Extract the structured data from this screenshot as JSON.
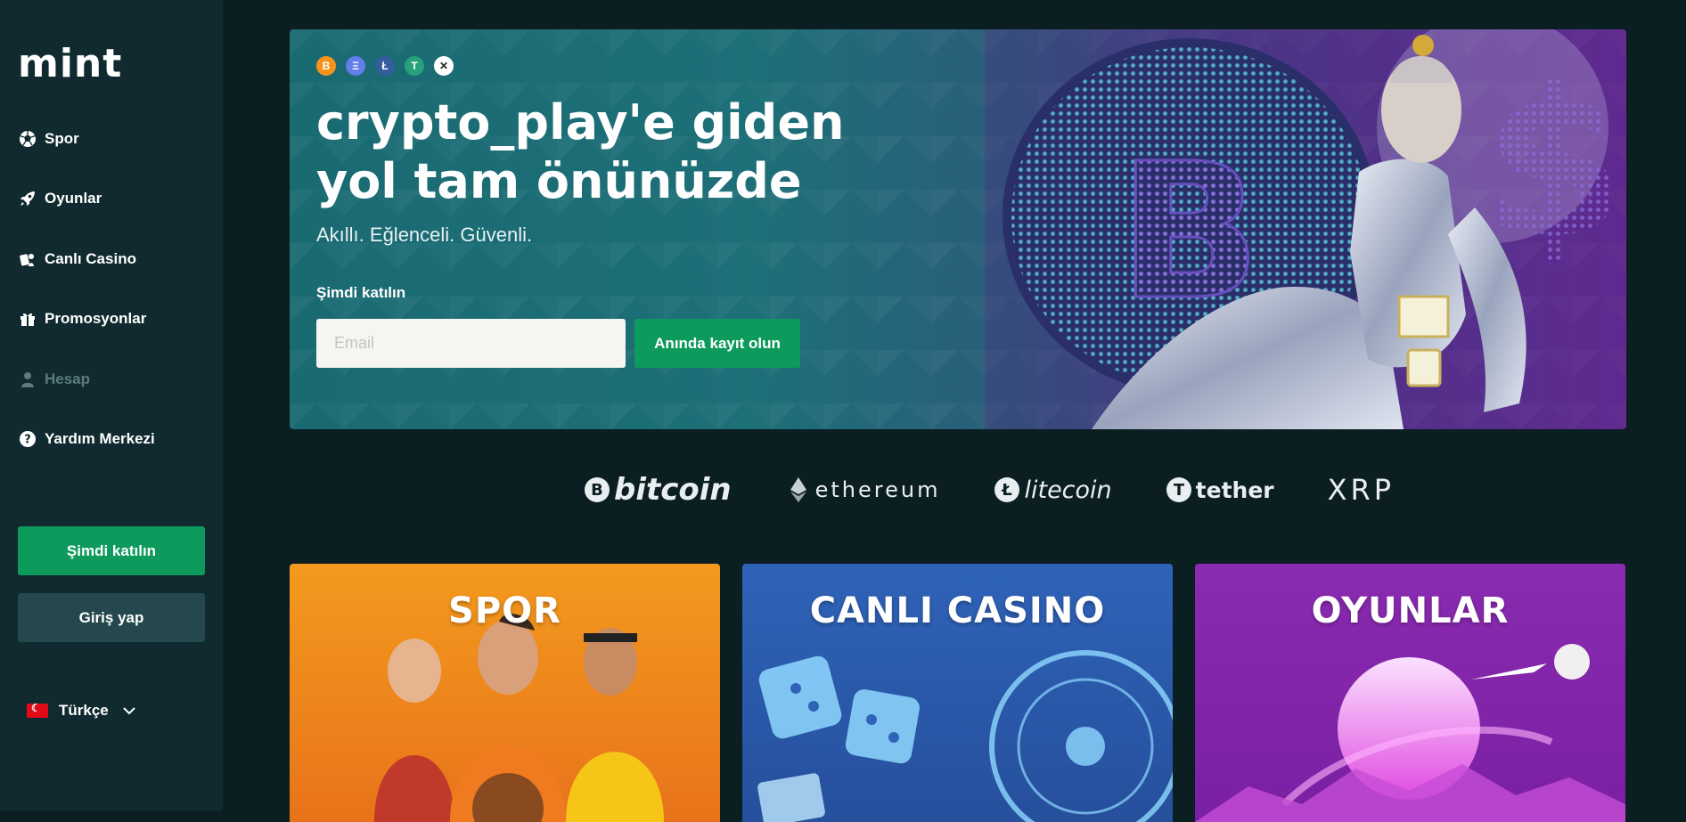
{
  "sidebar": {
    "logo": "mint",
    "nav": [
      {
        "label": "Spor",
        "icon": "soccer-ball-icon"
      },
      {
        "label": "Oyunlar",
        "icon": "rocket-icon"
      },
      {
        "label": "Canlı Casino",
        "icon": "dealer-icon"
      },
      {
        "label": "Promosyonlar",
        "icon": "gift-icon"
      },
      {
        "label": "Hesap",
        "icon": "user-icon",
        "disabled": true
      },
      {
        "label": "Yardım Merkezi",
        "icon": "help-icon"
      }
    ],
    "join_label": "Şimdi katılın",
    "login_label": "Giriş yap",
    "language": "Türkçe"
  },
  "hero": {
    "coins": [
      "B",
      "Ξ",
      "Ł",
      "T",
      "✕"
    ],
    "title_line1": "crypto_play'e giden",
    "title_line2": "yol tam önünüzde",
    "subtitle": "Akıllı. Eğlenceli. Güvenli.",
    "join_label": "Şimdi katılın",
    "email_placeholder": "Email",
    "register_label": "Anında kayıt olun"
  },
  "brands": {
    "bitcoin": "bitcoin",
    "ethereum": "ethereum",
    "litecoin": "litecoin",
    "tether": "tether",
    "xrp": "XRP"
  },
  "cards": {
    "spor": "SPOR",
    "casino": "CANLI CASINO",
    "oyunlar": "OYUNLAR"
  },
  "colors": {
    "accent_green": "#0e9a5c",
    "sidebar_bg": "#102a2f",
    "page_bg": "#0b1e22"
  }
}
